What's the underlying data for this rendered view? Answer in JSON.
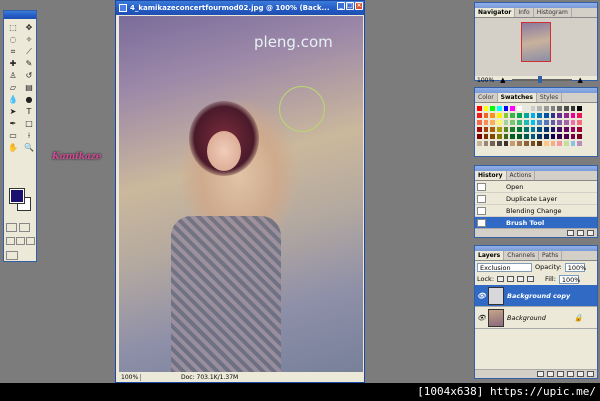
{
  "document": {
    "title": "4_kamikazeconcertfourmod02.jpg @ 100% (Back...",
    "status_zoom": "100%",
    "status_doc": "Doc: 703.1K/1.37M",
    "watermark": "pleng.com",
    "signature": "Kamikaze"
  },
  "navigator": {
    "tabs": [
      "Navigator",
      "Info",
      "Histogram"
    ],
    "zoom": "100%"
  },
  "swatches": {
    "tabs": [
      "Color",
      "Swatches",
      "Styles"
    ],
    "colors": [
      "#ff0000",
      "#ffff00",
      "#00ff00",
      "#00ffff",
      "#0000ff",
      "#ff00ff",
      "#ffffff",
      "#e6e6e6",
      "#cccccc",
      "#b3b3b3",
      "#999999",
      "#808080",
      "#666666",
      "#4d4d4d",
      "#333333",
      "#000000",
      "#ed1c24",
      "#f26522",
      "#f7941d",
      "#fff200",
      "#8dc63f",
      "#39b54a",
      "#00a651",
      "#00a99d",
      "#00aeef",
      "#0072bc",
      "#0054a6",
      "#2e3192",
      "#662d91",
      "#92278f",
      "#ec008c",
      "#ed145b",
      "#f26c4f",
      "#f68e56",
      "#fbaf5d",
      "#fff568",
      "#a3d39c",
      "#7cc576",
      "#3cb878",
      "#1cbbb4",
      "#00bff3",
      "#448ccb",
      "#5574b9",
      "#605ca8",
      "#8560a8",
      "#a763a8",
      "#f06eaa",
      "#f26d7d",
      "#9e0b0f",
      "#a0410d",
      "#a36209",
      "#aba000",
      "#598527",
      "#197b30",
      "#007236",
      "#00746b",
      "#0076a3",
      "#004a80",
      "#003471",
      "#1b1464",
      "#440e62",
      "#630460",
      "#9e005d",
      "#9e0039",
      "#790000",
      "#7b2e00",
      "#7d4900",
      "#827b00",
      "#406618",
      "#005e20",
      "#005826",
      "#005952",
      "#005b7f",
      "#003663",
      "#002157",
      "#0d004c",
      "#32004b",
      "#4b0049",
      "#7b0046",
      "#7a0026",
      "#c7b299",
      "#998675",
      "#736357",
      "#534741",
      "#37302d",
      "#c69c6d",
      "#a67c52",
      "#8c6239",
      "#754c24",
      "#603913",
      "#fdc689",
      "#f9ad81",
      "#f4989d",
      "#c4df9b",
      "#84c2e6",
      "#bd8cbf"
    ]
  },
  "history": {
    "tabs": [
      "History",
      "Actions"
    ],
    "items": [
      {
        "label": "Open",
        "active": false
      },
      {
        "label": "Duplicate Layer",
        "active": false
      },
      {
        "label": "Blending Change",
        "active": false
      },
      {
        "label": "Brush Tool",
        "active": true
      }
    ]
  },
  "layers": {
    "tabs": [
      "Layers",
      "Channels",
      "Paths"
    ],
    "blend_mode": "Exclusion",
    "opacity_label": "Opacity:",
    "opacity": "100%",
    "lock_label": "Lock:",
    "fill_label": "Fill:",
    "fill": "100%",
    "items": [
      {
        "name": "Background copy",
        "active": true
      },
      {
        "name": "Background",
        "active": false
      }
    ]
  },
  "footer": {
    "caption": "[1004x638] https://upic.me/"
  }
}
